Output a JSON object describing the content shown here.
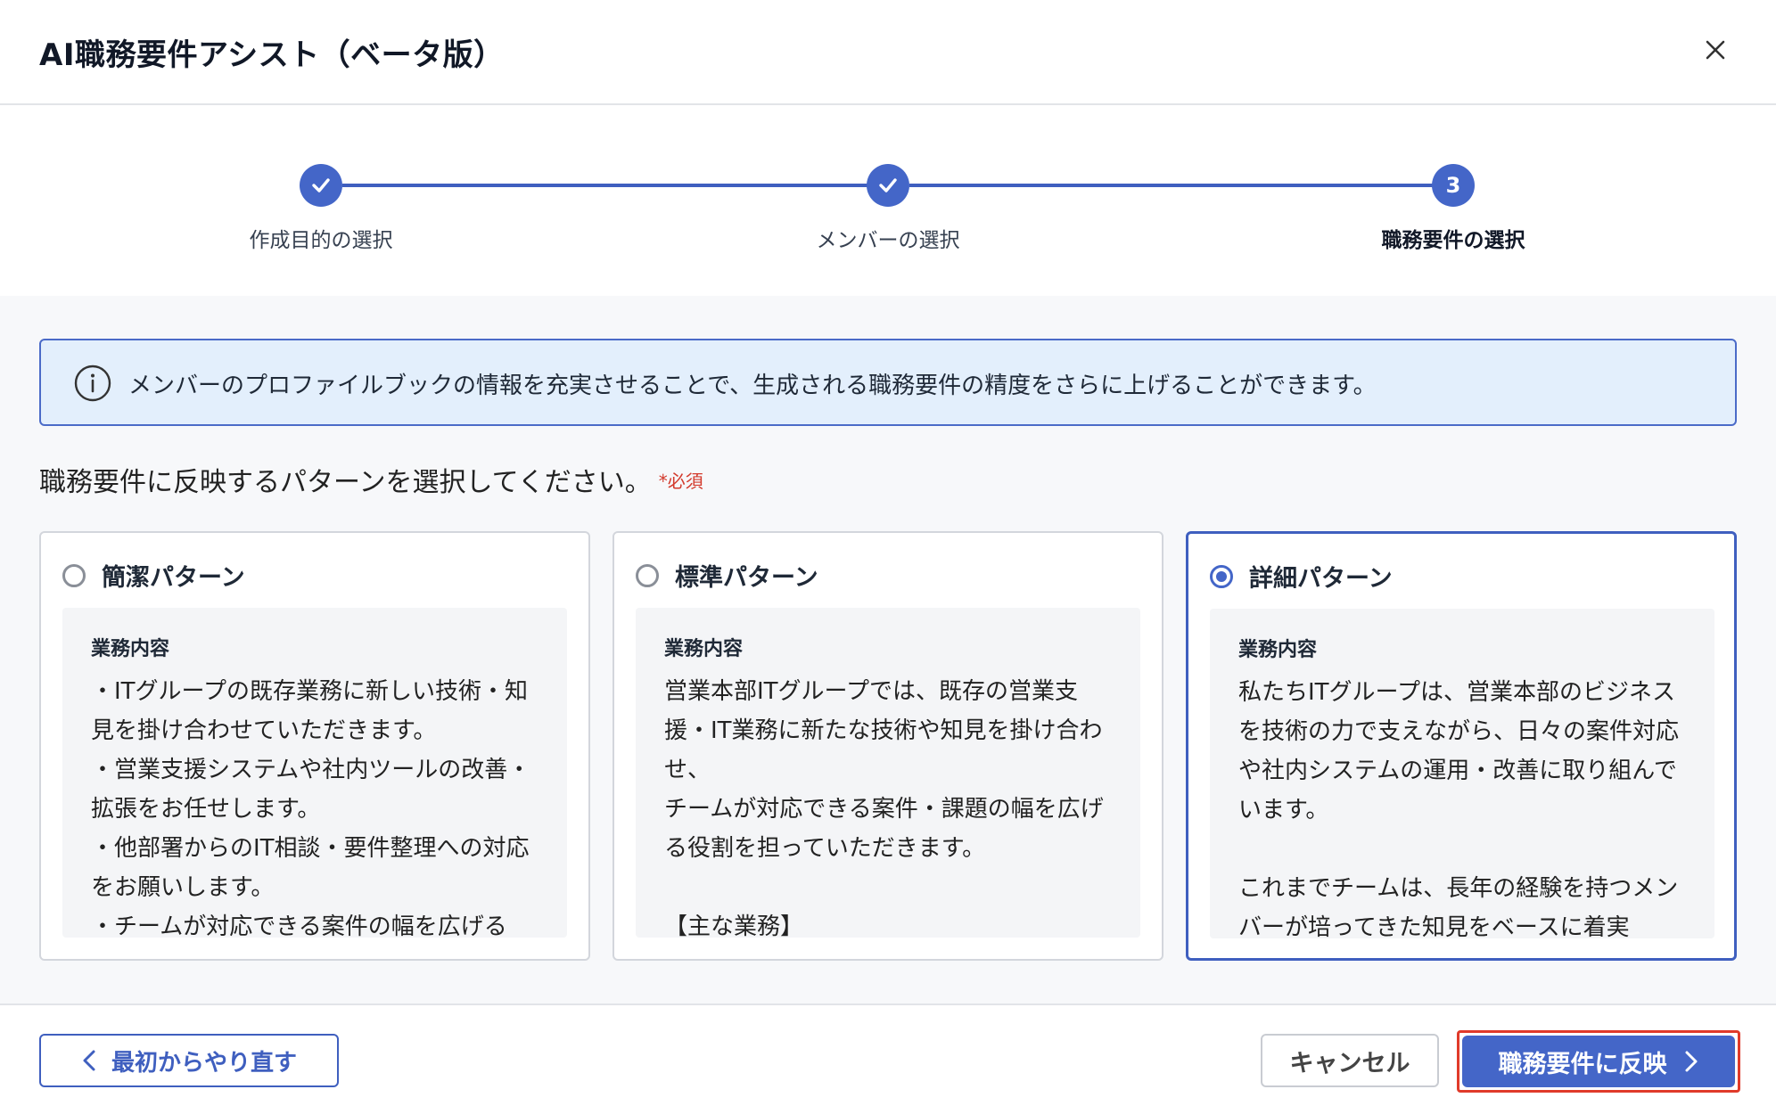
{
  "dialog": {
    "title": "AI職務要件アシスト（ベータ版）"
  },
  "stepper": {
    "steps": [
      {
        "label": "作成目的の選択",
        "state": "done",
        "marker": "check-icon"
      },
      {
        "label": "メンバーの選択",
        "state": "done",
        "marker": "check-icon"
      },
      {
        "label": "職務要件の選択",
        "state": "current",
        "marker": "3"
      }
    ]
  },
  "info": {
    "icon": "info-icon",
    "text": "メンバーのプロファイルブックの情報を充実させることで、生成される職務要件の精度をさらに上げることができます。"
  },
  "selection": {
    "prompt": "職務要件に反映するパターンを選択してください。",
    "required_label": "*必須",
    "selected": "詳細パターン"
  },
  "patterns": [
    {
      "title": "簡潔パターン",
      "checked": false,
      "preview_heading": "業務内容",
      "preview_text": "・ITグループの既存業務に新しい技術・知見を掛け合わせていただきます。\n・営業支援システムや社内ツールの改善・拡張をお任せします。\n・他部署からのIT相談・要件整理への対応をお願いします。\n・チームが対応できる案件の幅を広げる"
    },
    {
      "title": "標準パターン",
      "checked": false,
      "preview_heading": "業務内容",
      "preview_text": "営業本部ITグループでは、既存の営業支援・IT業務に新たな技術や知見を掛け合わせ、\nチームが対応できる案件・課題の幅を広げる役割を担っていただきます。\n\n【主な業務】"
    },
    {
      "title": "詳細パターン",
      "checked": true,
      "preview_heading": "業務内容",
      "preview_text": "私たちITグループは、営業本部のビジネスを技術の力で支えながら、日々の案件対応や社内システムの運用・改善に取り組んでいます。\n\nこれまでチームは、長年の経験を持つメンバーが培ってきた知見をベースに着実"
    }
  ],
  "footer": {
    "restart_label": "最初からやり直す",
    "cancel_label": "キャンセル",
    "apply_label": "職務要件に反映"
  },
  "colors": {
    "primary": "#4466c8",
    "info_bg": "#e3effc",
    "required": "#d33a2c",
    "highlight_outline": "#e03a2a"
  }
}
